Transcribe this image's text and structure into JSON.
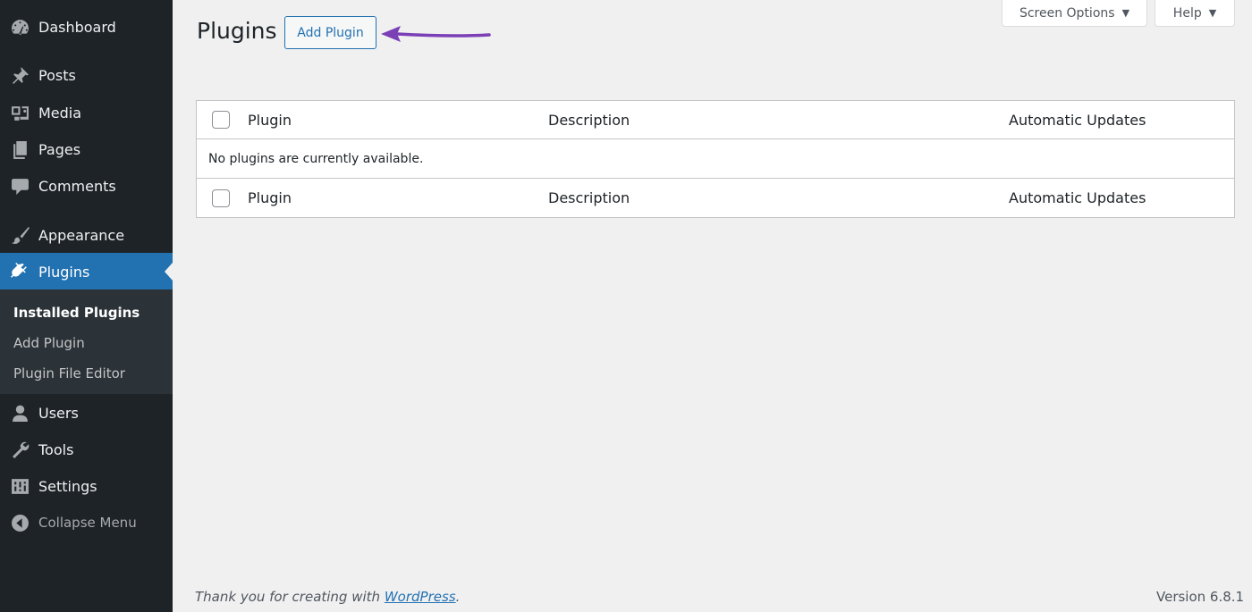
{
  "sidebar": {
    "items": [
      {
        "label": "Dashboard",
        "icon": "dashboard-icon"
      },
      {
        "label": "Posts",
        "icon": "pin-icon"
      },
      {
        "label": "Media",
        "icon": "media-icon"
      },
      {
        "label": "Pages",
        "icon": "pages-icon"
      },
      {
        "label": "Comments",
        "icon": "comment-icon"
      },
      {
        "label": "Appearance",
        "icon": "brush-icon"
      },
      {
        "label": "Plugins",
        "icon": "plug-icon",
        "active": true
      },
      {
        "label": "Users",
        "icon": "user-icon"
      },
      {
        "label": "Tools",
        "icon": "wrench-icon"
      },
      {
        "label": "Settings",
        "icon": "settings-icon"
      },
      {
        "label": "Collapse Menu",
        "icon": "collapse-icon"
      }
    ],
    "submenu": [
      {
        "label": "Installed Plugins",
        "current": true
      },
      {
        "label": "Add Plugin"
      },
      {
        "label": "Plugin File Editor"
      }
    ]
  },
  "header": {
    "title": "Plugins",
    "add_button": "Add Plugin",
    "screen_options": "Screen Options",
    "help": "Help"
  },
  "table": {
    "columns": {
      "plugin": "Plugin",
      "description": "Description",
      "auto_updates": "Automatic Updates"
    },
    "empty_message": "No plugins are currently available."
  },
  "footer": {
    "thanks_prefix": "Thank you for creating with ",
    "thanks_link": "WordPress",
    "thanks_suffix": ".",
    "version": "Version 6.8.1"
  },
  "colors": {
    "sidebar_bg": "#1d2327",
    "accent": "#2271b1",
    "arrow": "#7b3fb6"
  }
}
